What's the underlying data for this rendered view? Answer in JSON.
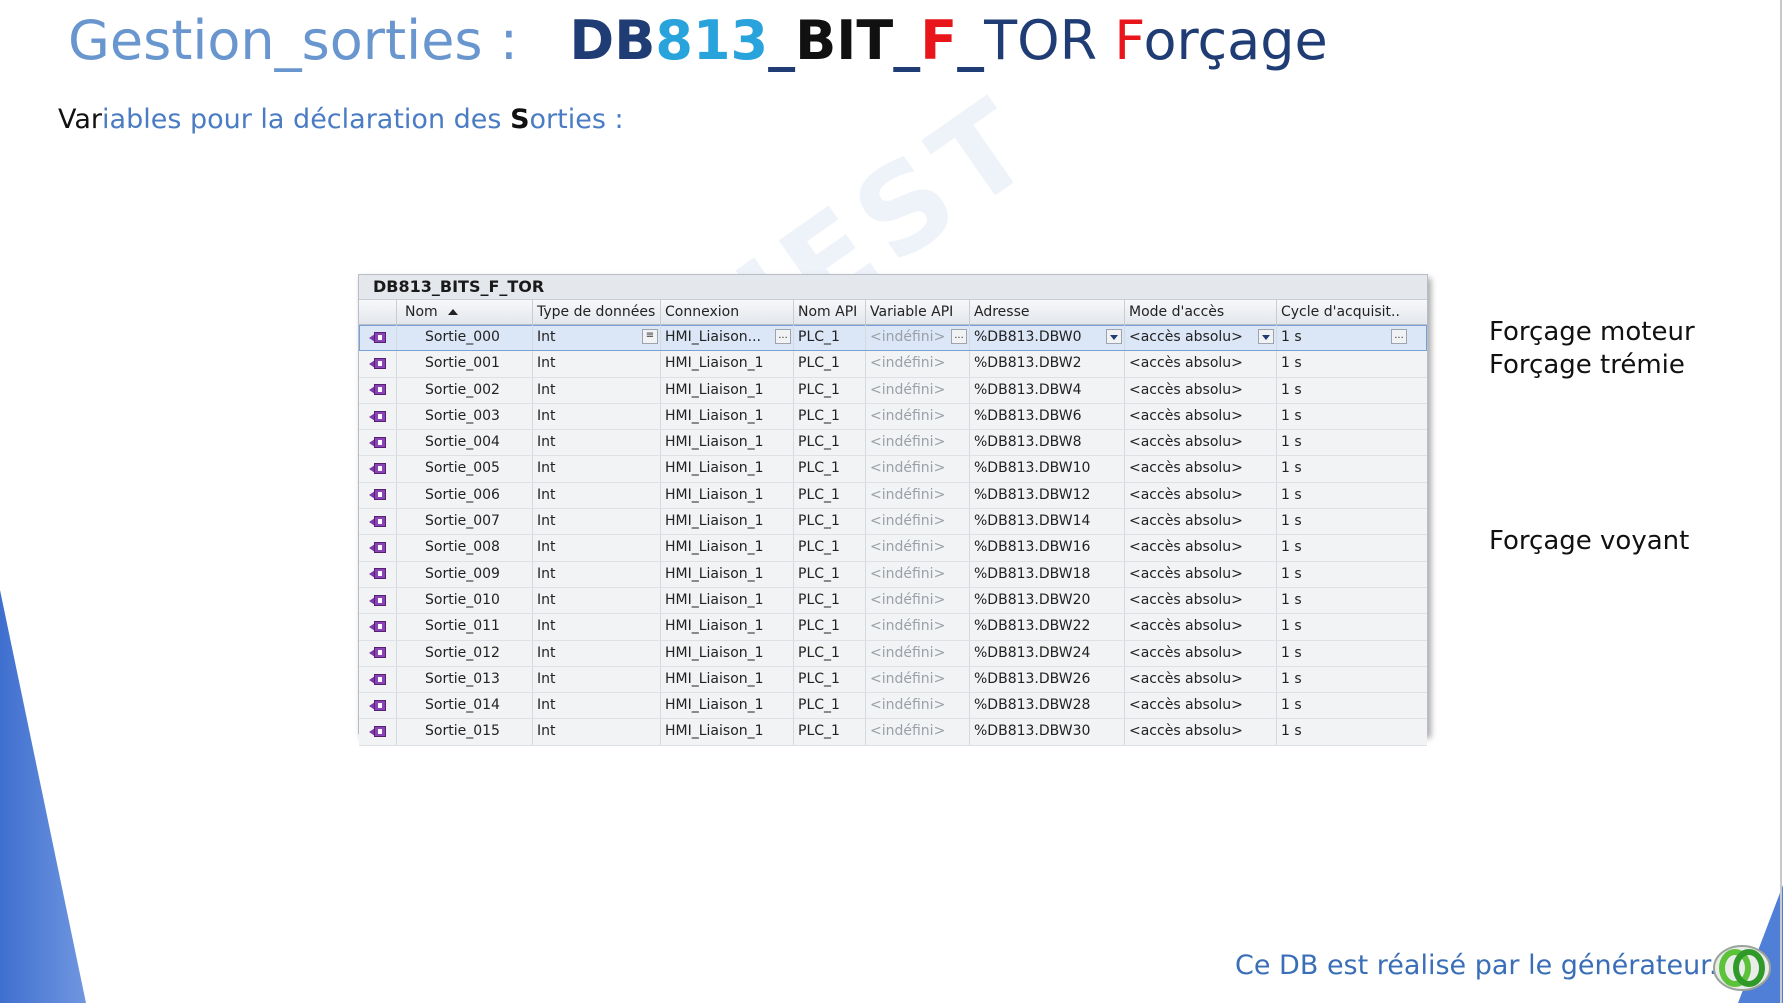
{
  "title": {
    "prefix": "Gestion_sorties :",
    "db": "DB",
    "num": "813",
    "sep1": "_",
    "bit": "BIT",
    "sep2": "_",
    "f": "F",
    "sep3": "_",
    "tor": "TOR",
    "forcage_f": "F",
    "forcage_rest": "orçage"
  },
  "subtitle": {
    "a": "Var",
    "b": "iables pour la déclaration des ",
    "c": "S",
    "d": "orties :"
  },
  "watermark": "AEI OUEST",
  "table": {
    "title": "DB813_BITS_F_TOR",
    "headers": {
      "nom": "Nom",
      "type": "Type de données",
      "connexion": "Connexion",
      "nom_api": "Nom API",
      "variable_api": "Variable API",
      "adresse": "Adresse",
      "mode": "Mode d'accès",
      "cycle": "Cycle d'acquisit.."
    },
    "rows": [
      {
        "nom": "Sortie_000",
        "type": "Int",
        "connexion": "HMI_Liaison...",
        "api": "PLC_1",
        "var": "<indéfini>",
        "adresse": "%DB813.DBW0",
        "mode": "<accès absolu>",
        "cycle": "1 s"
      },
      {
        "nom": "Sortie_001",
        "type": "Int",
        "connexion": "HMI_Liaison_1",
        "api": "PLC_1",
        "var": "<indéfini>",
        "adresse": "%DB813.DBW2",
        "mode": "<accès absolu>",
        "cycle": "1 s"
      },
      {
        "nom": "Sortie_002",
        "type": "Int",
        "connexion": "HMI_Liaison_1",
        "api": "PLC_1",
        "var": "<indéfini>",
        "adresse": "%DB813.DBW4",
        "mode": "<accès absolu>",
        "cycle": "1 s"
      },
      {
        "nom": "Sortie_003",
        "type": "Int",
        "connexion": "HMI_Liaison_1",
        "api": "PLC_1",
        "var": "<indéfini>",
        "adresse": "%DB813.DBW6",
        "mode": "<accès absolu>",
        "cycle": "1 s"
      },
      {
        "nom": "Sortie_004",
        "type": "Int",
        "connexion": "HMI_Liaison_1",
        "api": "PLC_1",
        "var": "<indéfini>",
        "adresse": "%DB813.DBW8",
        "mode": "<accès absolu>",
        "cycle": "1 s"
      },
      {
        "nom": "Sortie_005",
        "type": "Int",
        "connexion": "HMI_Liaison_1",
        "api": "PLC_1",
        "var": "<indéfini>",
        "adresse": "%DB813.DBW10",
        "mode": "<accès absolu>",
        "cycle": "1 s"
      },
      {
        "nom": "Sortie_006",
        "type": "Int",
        "connexion": "HMI_Liaison_1",
        "api": "PLC_1",
        "var": "<indéfini>",
        "adresse": "%DB813.DBW12",
        "mode": "<accès absolu>",
        "cycle": "1 s"
      },
      {
        "nom": "Sortie_007",
        "type": "Int",
        "connexion": "HMI_Liaison_1",
        "api": "PLC_1",
        "var": "<indéfini>",
        "adresse": "%DB813.DBW14",
        "mode": "<accès absolu>",
        "cycle": "1 s"
      },
      {
        "nom": "Sortie_008",
        "type": "Int",
        "connexion": "HMI_Liaison_1",
        "api": "PLC_1",
        "var": "<indéfini>",
        "adresse": "%DB813.DBW16",
        "mode": "<accès absolu>",
        "cycle": "1 s"
      },
      {
        "nom": "Sortie_009",
        "type": "Int",
        "connexion": "HMI_Liaison_1",
        "api": "PLC_1",
        "var": "<indéfini>",
        "adresse": "%DB813.DBW18",
        "mode": "<accès absolu>",
        "cycle": "1 s"
      },
      {
        "nom": "Sortie_010",
        "type": "Int",
        "connexion": "HMI_Liaison_1",
        "api": "PLC_1",
        "var": "<indéfini>",
        "adresse": "%DB813.DBW20",
        "mode": "<accès absolu>",
        "cycle": "1 s"
      },
      {
        "nom": "Sortie_011",
        "type": "Int",
        "connexion": "HMI_Liaison_1",
        "api": "PLC_1",
        "var": "<indéfini>",
        "adresse": "%DB813.DBW22",
        "mode": "<accès absolu>",
        "cycle": "1 s"
      },
      {
        "nom": "Sortie_012",
        "type": "Int",
        "connexion": "HMI_Liaison_1",
        "api": "PLC_1",
        "var": "<indéfini>",
        "adresse": "%DB813.DBW24",
        "mode": "<accès absolu>",
        "cycle": "1 s"
      },
      {
        "nom": "Sortie_013",
        "type": "Int",
        "connexion": "HMI_Liaison_1",
        "api": "PLC_1",
        "var": "<indéfini>",
        "adresse": "%DB813.DBW26",
        "mode": "<accès absolu>",
        "cycle": "1 s"
      },
      {
        "nom": "Sortie_014",
        "type": "Int",
        "connexion": "HMI_Liaison_1",
        "api": "PLC_1",
        "var": "<indéfini>",
        "adresse": "%DB813.DBW28",
        "mode": "<accès absolu>",
        "cycle": "1 s"
      },
      {
        "nom": "Sortie_015",
        "type": "Int",
        "connexion": "HMI_Liaison_1",
        "api": "PLC_1",
        "var": "<indéfini>",
        "adresse": "%DB813.DBW30",
        "mode": "<accès absolu>",
        "cycle": "1 s"
      }
    ]
  },
  "notes": {
    "moteur": "Forçage moteur",
    "tremie": "Forçage trémie",
    "voyant": "Forçage voyant"
  },
  "footer": "Ce DB est réalisé par le générateur.",
  "icons": {
    "tag": "hmi-tag-icon",
    "logo": "aei-rings-logo"
  },
  "colors": {
    "title_light": "#6a96cf",
    "title_dark": "#1f3c74",
    "accent_cyan": "#29a3dc",
    "accent_red": "#e8161b",
    "selection": "#dbe6f7",
    "wedge": "#4f7fd6"
  }
}
